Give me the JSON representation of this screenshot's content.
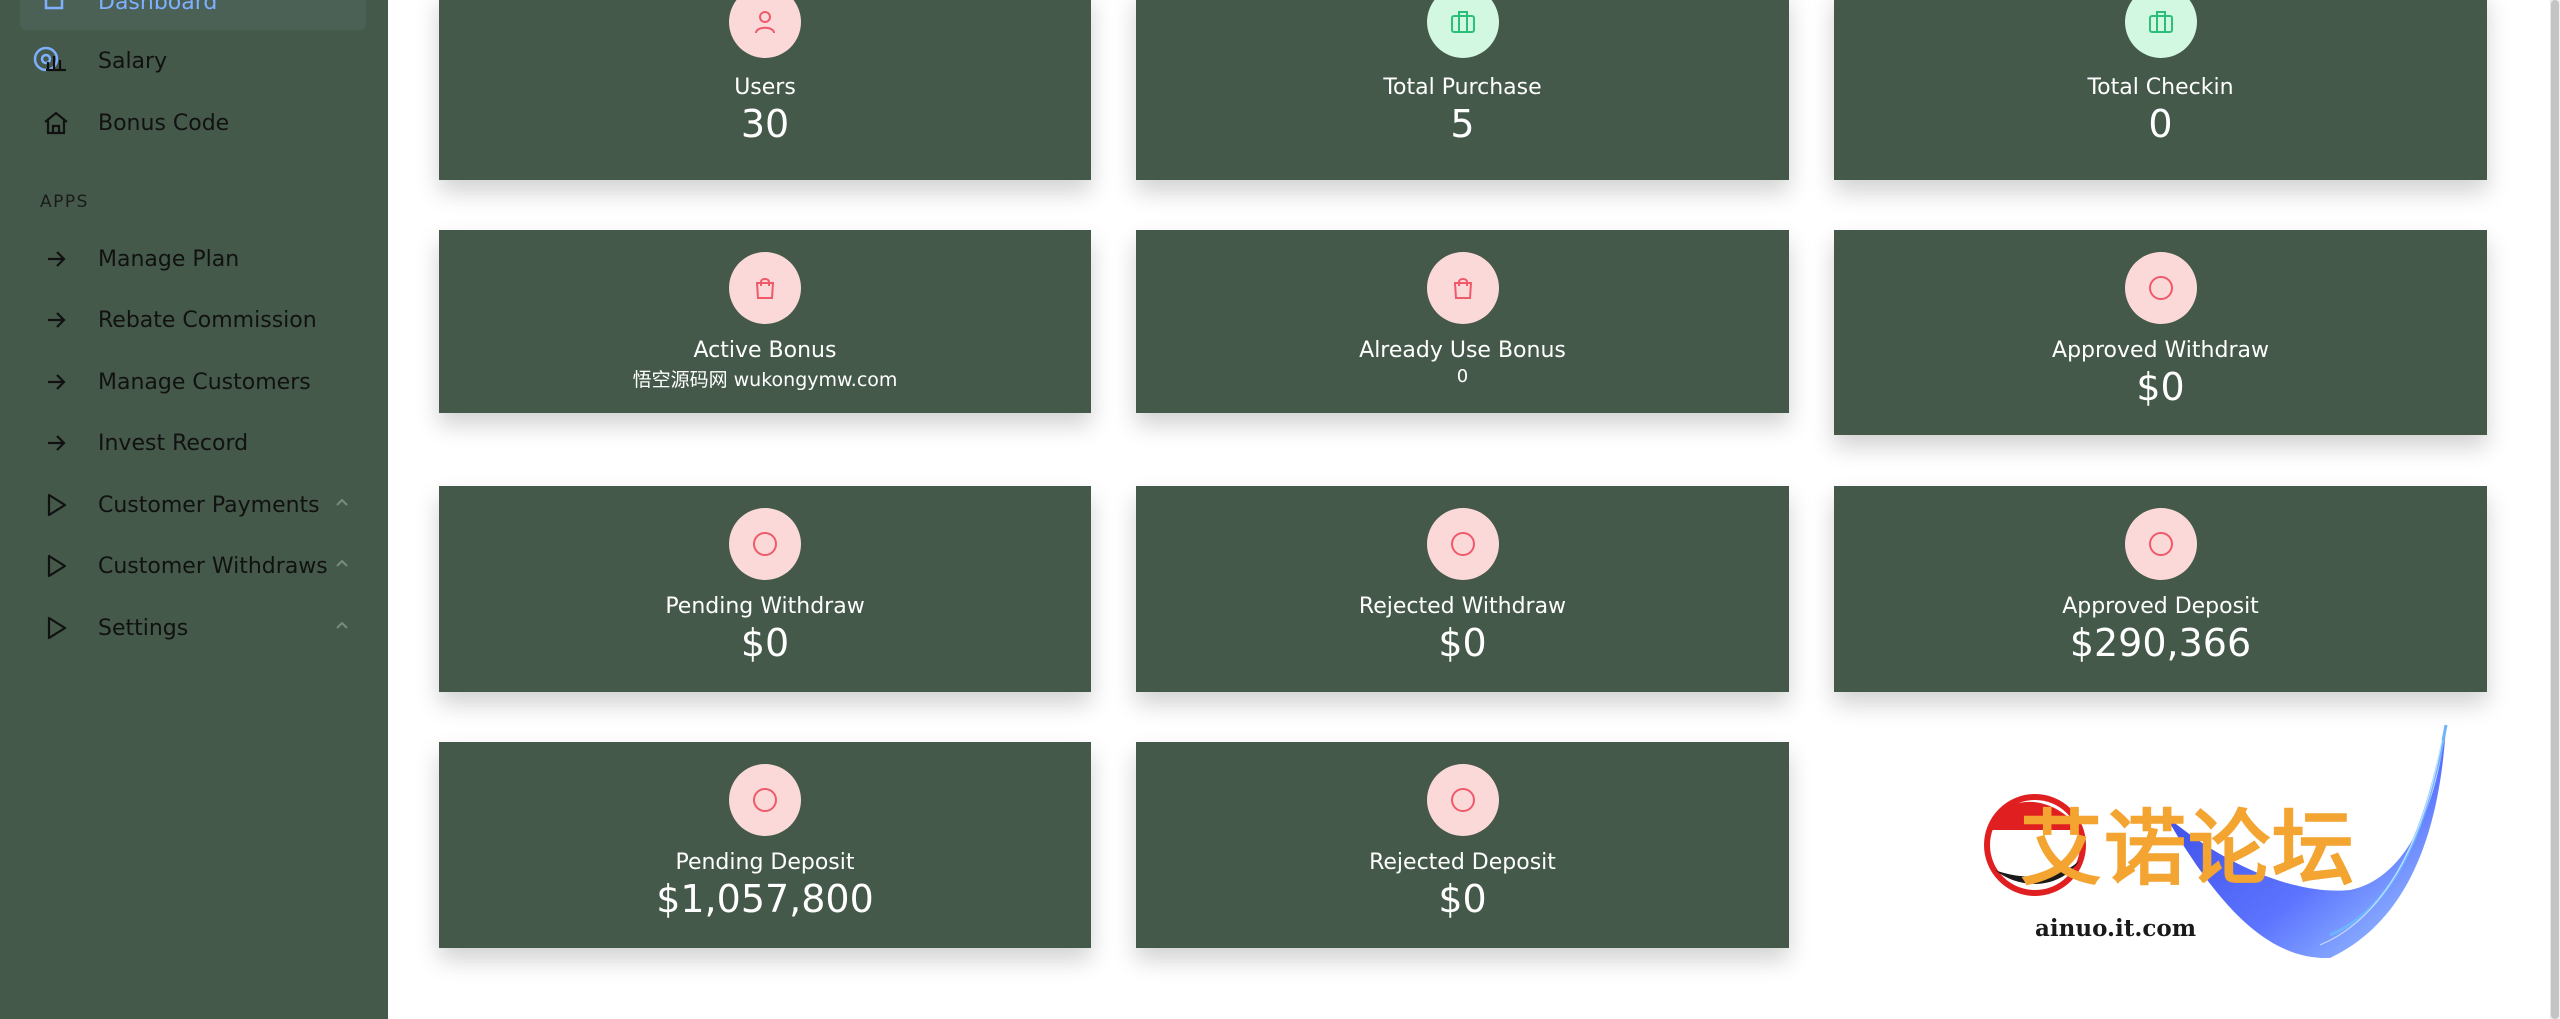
{
  "sidebar": {
    "active_item": "Dashboard",
    "items_top": [
      "Salary",
      "Bonus Code"
    ],
    "section_label": "APPS",
    "apps_items": [
      "Manage Plan",
      "Rebate Commission",
      "Manage Customers",
      "Invest Record"
    ],
    "expandable_items": [
      "Customer Payments",
      "Customer Withdraws",
      "Settings"
    ]
  },
  "cards": [
    {
      "title": "Users",
      "value": "30"
    },
    {
      "title": "Total Purchase",
      "value": "5"
    },
    {
      "title": "Total Checkin",
      "value": "0"
    },
    {
      "title": "Active Bonus",
      "value": "悟空源码网 wukongymw.com"
    },
    {
      "title": "Already Use Bonus",
      "value": "0"
    },
    {
      "title": "Approved Withdraw",
      "value": "$0"
    },
    {
      "title": "Pending Withdraw",
      "value": "$0"
    },
    {
      "title": "Rejected Withdraw",
      "value": "$0"
    },
    {
      "title": "Approved Deposit",
      "value": "$290,366"
    },
    {
      "title": "Pending Deposit",
      "value": "$1,057,800"
    },
    {
      "title": "Rejected Deposit",
      "value": "$0"
    }
  ],
  "watermark": {
    "text": "艾诺论坛",
    "url": "ainuo.it.com"
  },
  "colors": {
    "sidebar_bg": "#44594a",
    "card_bg": "#44594a",
    "icon_red_bg": "#fcd9d9",
    "icon_green_bg": "#d2f8e2",
    "icon_red": "#ef5a6a",
    "icon_green": "#2bbf7a",
    "active_text": "#7fb0ff"
  }
}
